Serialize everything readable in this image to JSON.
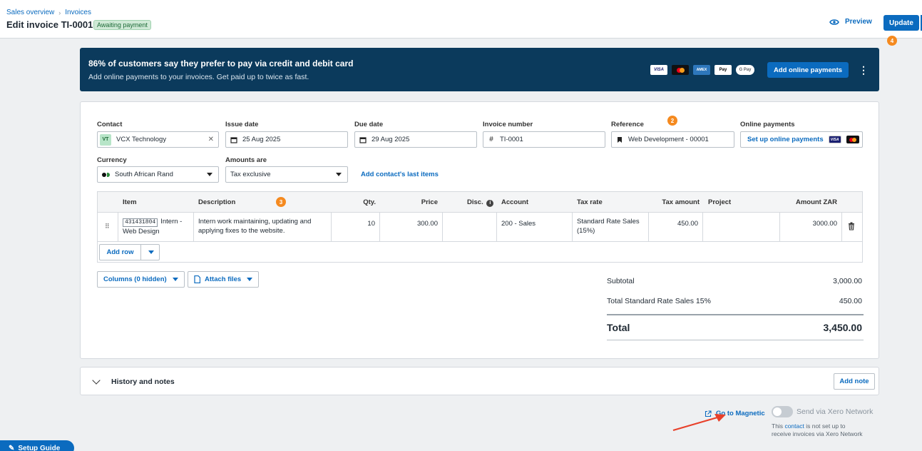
{
  "breadcrumb": [
    "Sales overview",
    "Invoices"
  ],
  "page_title": "Edit invoice TI-0001",
  "status": "Awaiting payment",
  "header": {
    "preview": "Preview",
    "update": "Update"
  },
  "step_badges": {
    "update": "4",
    "reference": "2",
    "description": "3"
  },
  "promo": {
    "title": "86% of customers say they prefer to pay via credit and debit card",
    "subtitle": "Add online payments to your invoices. Get paid up to twice as fast.",
    "cards": [
      "VISA",
      "Mastercard",
      "AMEX",
      "Pay",
      "G Pay"
    ],
    "cta": "Add online payments"
  },
  "form": {
    "contact": {
      "label": "Contact",
      "badge": "VT",
      "value": "VCX Technology"
    },
    "issue_date": {
      "label": "Issue date",
      "value": "25 Aug 2025"
    },
    "due_date": {
      "label": "Due date",
      "value": "29 Aug 2025"
    },
    "invoice_number": {
      "label": "Invoice number",
      "value": "TI-0001"
    },
    "reference": {
      "label": "Reference",
      "value": "Web Development - 00001"
    },
    "online_payments": {
      "label": "Online payments",
      "value": "Set up online payments"
    },
    "currency": {
      "label": "Currency",
      "value": "South African Rand"
    },
    "amounts_are": {
      "label": "Amounts are",
      "value": "Tax exclusive"
    },
    "last_items_link": "Add contact's last items"
  },
  "table": {
    "headers": {
      "item": "Item",
      "description": "Description",
      "qty": "Qty.",
      "price": "Price",
      "disc": "Disc.",
      "account": "Account",
      "tax_rate": "Tax rate",
      "tax_amount": "Tax amount",
      "project": "Project",
      "amount": "Amount ZAR"
    },
    "rows": [
      {
        "code": "431431804",
        "item": "Intern - Web Design",
        "description": "Intern work maintaining, updating and applying fixes to the website.",
        "qty": "10",
        "price": "300.00",
        "disc": "",
        "account": "200 - Sales",
        "tax_rate": "Standard Rate Sales (15%)",
        "tax_amount": "450.00",
        "project": "",
        "amount": "3000.00"
      }
    ],
    "add_row": "Add row"
  },
  "columns_button": "Columns (0 hidden)",
  "attach_button": "Attach files",
  "totals": {
    "subtotal_label": "Subtotal",
    "subtotal": "3,000.00",
    "tax_label": "Total Standard Rate Sales 15%",
    "tax": "450.00",
    "total_label": "Total",
    "total": "3,450.00"
  },
  "history": {
    "title": "History and notes",
    "add_note": "Add note"
  },
  "bottom": {
    "magnetic": "Go to Magnetic",
    "send_label": "Send via Xero Network",
    "note_prefix": "This",
    "note_link": "contact",
    "note_suffix": "is not set up to receive invoices via Xero Network",
    "setup_guide": "Setup Guide"
  },
  "colors": {
    "accent": "#0b6bbf",
    "banner": "#0b3a5c",
    "badge": "#f58a1f",
    "arrow": "#e8402a"
  }
}
